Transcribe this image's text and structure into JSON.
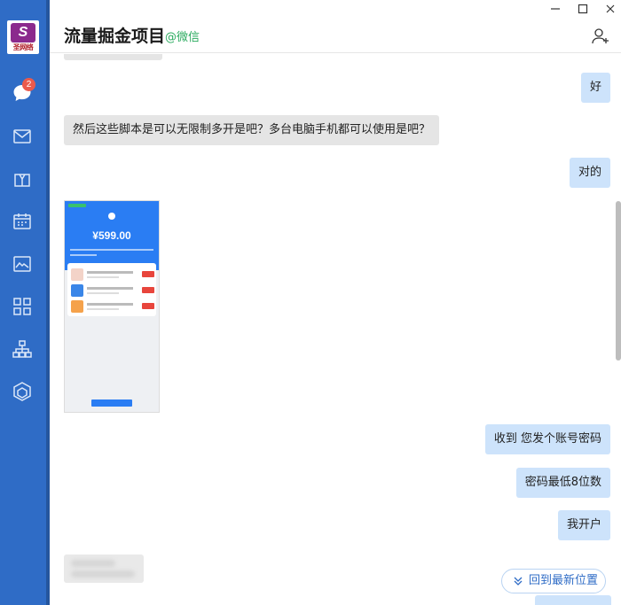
{
  "app": {
    "logo_text": "圣网络"
  },
  "sidebar": {
    "badge_count": "2",
    "items": [
      {
        "icon": "chat-icon"
      },
      {
        "icon": "mail-icon"
      },
      {
        "icon": "bag-icon"
      },
      {
        "icon": "calendar-icon"
      },
      {
        "icon": "image-gallery-icon"
      },
      {
        "icon": "apps-grid-icon"
      },
      {
        "icon": "org-chart-icon"
      },
      {
        "icon": "cube-icon"
      }
    ]
  },
  "header": {
    "title": "流量掘金项目",
    "source": "@微信"
  },
  "messages": [
    {
      "from": "me",
      "text": "好"
    },
    {
      "from": "them",
      "text": "然后这些脚本是可以无限制多开是吧？多台电脑手机都可以使用是吧？"
    },
    {
      "from": "me",
      "text": "对的"
    },
    {
      "from": "them",
      "type": "image",
      "amount": "¥599.00"
    },
    {
      "from": "me",
      "text": "收到  您发个账号密码"
    },
    {
      "from": "me",
      "text": "密码最低8位数"
    },
    {
      "from": "me",
      "text": "我开户"
    }
  ],
  "back_to_latest_label": "回到最新位置",
  "colors": {
    "sidebar": "#2f6cc6",
    "my_bubble": "#cde3fb",
    "their_bubble": "#e5e5e5",
    "source_green": "#2bab5f",
    "badge": "#ea5a4c"
  }
}
